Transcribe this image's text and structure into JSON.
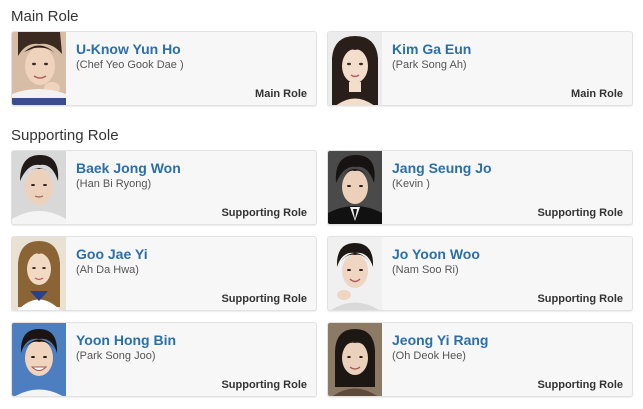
{
  "sections": {
    "main": {
      "heading": "Main Role",
      "cards": [
        {
          "name": "U-Know Yun Ho",
          "character": "(Chef Yeo Gook Dae )",
          "role": "Main Role",
          "photo": "actor-photo"
        },
        {
          "name": "Kim Ga Eun",
          "character": "(Park Song Ah)",
          "role": "Main Role",
          "photo": "actor-photo"
        }
      ]
    },
    "supporting": {
      "heading": "Supporting Role",
      "cards": [
        {
          "name": "Baek Jong Won",
          "character": "(Han Bi Ryong)",
          "role": "Supporting Role",
          "photo": "actor-photo"
        },
        {
          "name": "Jang Seung Jo",
          "character": "(Kevin )",
          "role": "Supporting Role",
          "photo": "actor-photo"
        },
        {
          "name": "Goo Jae Yi",
          "character": "(Ah Da Hwa)",
          "role": "Supporting Role",
          "photo": "actor-photo"
        },
        {
          "name": "Jo Yoon Woo",
          "character": "(Nam Soo Ri)",
          "role": "Supporting Role",
          "photo": "actor-photo"
        },
        {
          "name": "Yoon Hong Bin",
          "character": "(Park Song Joo)",
          "role": "Supporting Role",
          "photo": "actor-photo"
        },
        {
          "name": "Jeong Yi Rang",
          "character": "(Oh Deok Hee)",
          "role": "Supporting Role",
          "photo": "actor-photo"
        }
      ]
    }
  },
  "colors": {
    "name_link": "#2a6fa8",
    "card_bg": "#f7f7f7",
    "card_border": "#e2e2e2"
  }
}
